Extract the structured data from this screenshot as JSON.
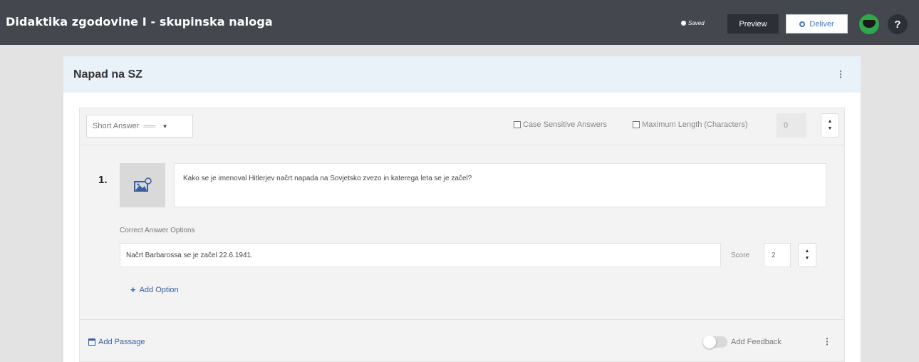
{
  "header": {
    "title": "Didaktika zgodovine I - skupinska naloga",
    "saved_label": "Saved",
    "preview_label": "Preview",
    "deliver_label": "Deliver",
    "help_label": "?"
  },
  "section": {
    "title": "Napad na SZ",
    "menu_icon": "more-vertical-icon"
  },
  "question_toolbar": {
    "type_label": "Short Answer",
    "case_sensitive_label": "Case Sensitive Answers",
    "max_length_label": "Maximum Length (Characters)",
    "max_length_value": "0"
  },
  "question": {
    "number": "1.",
    "text": "Kako se je imenoval Hitlerjev načrt napada na Sovjetsko zvezo in katerega leta se je začel?",
    "image_icon": "image-add-icon"
  },
  "answers": {
    "label": "Correct Answer Options",
    "options": [
      {
        "text": "Načrt Barbarossa se je začel 22.6.1941.",
        "score_label": "Score",
        "score": "2"
      }
    ],
    "add_option_label": "Add Option"
  },
  "footer": {
    "add_passage_label": "Add Passage",
    "add_feedback_label": "Add Feedback",
    "feedback_enabled": false
  },
  "colors": {
    "topbar": "#45474f",
    "accent": "#3a7bc8",
    "link": "#3a5f9f",
    "avatar": "#2ea84b",
    "section_header": "#e9f1f9"
  }
}
